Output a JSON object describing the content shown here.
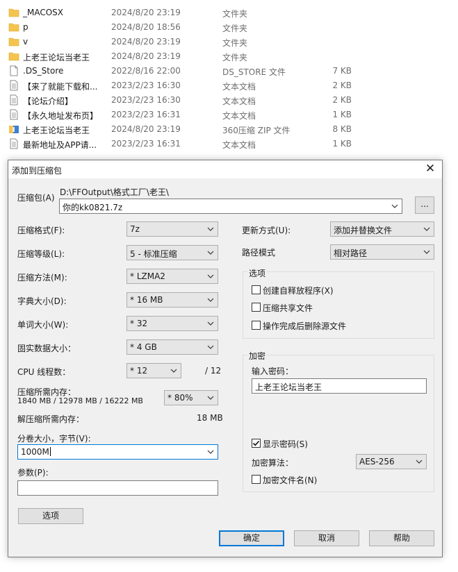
{
  "files": [
    {
      "name": "_MACOSX",
      "date": "2024/8/20 23:19",
      "type": "文件夹",
      "size": "",
      "icon": "folder-icon"
    },
    {
      "name": "p",
      "date": "2024/8/20 18:56",
      "type": "文件夹",
      "size": "",
      "icon": "folder-icon"
    },
    {
      "name": "v",
      "date": "2024/8/20 23:19",
      "type": "文件夹",
      "size": "",
      "icon": "folder-icon"
    },
    {
      "name": "上老王论坛当老王",
      "date": "2024/8/20 23:19",
      "type": "文件夹",
      "size": "",
      "icon": "folder-icon"
    },
    {
      "name": ".DS_Store",
      "date": "2022/8/16 22:00",
      "type": "DS_STORE 文件",
      "size": "7 KB",
      "icon": "file-icon"
    },
    {
      "name": "【来了就能下载和...",
      "date": "2023/2/23 16:30",
      "type": "文本文档",
      "size": "2 KB",
      "icon": "text-file-icon"
    },
    {
      "name": "【论坛介绍】",
      "date": "2023/2/23 16:30",
      "type": "文本文档",
      "size": "2 KB",
      "icon": "text-file-icon"
    },
    {
      "name": "【永久地址发布页】",
      "date": "2023/2/23 16:31",
      "type": "文本文档",
      "size": "1 KB",
      "icon": "text-file-icon"
    },
    {
      "name": "上老王论坛当老王",
      "date": "2024/8/20 23:19",
      "type": "360压缩 ZIP 文件",
      "size": "8 KB",
      "icon": "zip-archive-icon"
    },
    {
      "name": "最新地址及APP请...",
      "date": "2023/2/23 16:31",
      "type": "文本文档",
      "size": "1 KB",
      "icon": "text-file-icon"
    }
  ],
  "dialog": {
    "title": "添加到压缩包",
    "close_symbol": "✕",
    "archive_label": "压缩包(A)",
    "archive_path": "D:\\FFOutput\\格式工厂\\老王\\",
    "archive_name": "你的kk0821.7z",
    "browse_label": "...",
    "format_label": "压缩格式(F):",
    "format_value": "7z",
    "level_label": "压缩等级(L):",
    "level_value": "5 - 标准压缩",
    "method_label": "压缩方法(M):",
    "method_value": "* LZMA2",
    "dict_label": "字典大小(D):",
    "dict_value": "* 16 MB",
    "word_label": "单词大小(W):",
    "word_value": "* 32",
    "solid_label": "固实数据大小：",
    "solid_value": "* 4 GB",
    "cpu_label": "CPU 线程数：",
    "cpu_value": "* 12",
    "cpu_total": "/ 12",
    "mem_label": "压缩所需内存：",
    "mem_detail": "1840 MB / 12978 MB / 16222 MB",
    "mem_percent": "* 80%",
    "decomp_label": "解压缩所需内存：",
    "decomp_value": "18 MB",
    "split_label": "分卷大小，字节(V):",
    "split_value": "1000M",
    "params_label": "参数(P):",
    "params_value": "",
    "options_button": "选项",
    "update_label": "更新方式(U):",
    "update_value": "添加并替换文件",
    "path_label": "路径模式",
    "path_value": "相对路径",
    "options_group": "选项",
    "opt_sfx": "创建自释放程序(X)",
    "opt_shared": "压缩共享文件",
    "opt_delete": "操作完成后删除源文件",
    "enc_group": "加密",
    "password_label": "输入密码：",
    "password_value": "上老王论坛当老王",
    "show_password": "显示密码(S)",
    "show_password_checked": true,
    "enc_method_label": "加密算法：",
    "enc_method_value": "AES-256",
    "enc_names": "加密文件名(N)",
    "ok": "确定",
    "cancel": "取消",
    "help": "帮助"
  },
  "colors": {
    "folder": "#f4c44e",
    "accent": "#0078d7",
    "dialog_bg": "#f0f0f0"
  }
}
